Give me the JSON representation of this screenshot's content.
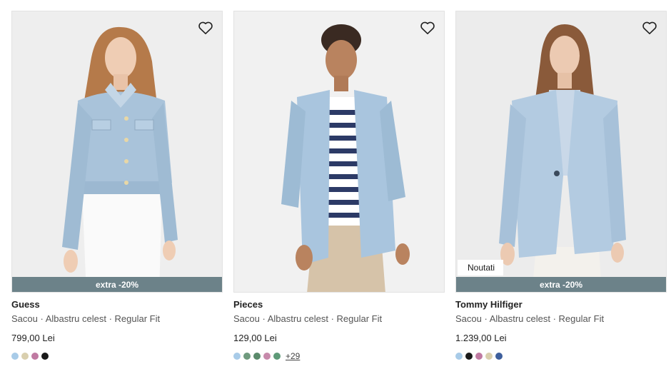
{
  "products": [
    {
      "brand": "Guess",
      "desc": "Sacou · Albastru celest · Regular Fit",
      "price": "799,00 Lei",
      "promo": "extra -20%",
      "badge": "",
      "image": "model-wearing-light-blue-tweed-jacket",
      "swatches": [
        "#a8cbe8",
        "#d9cfae",
        "#c07aa2",
        "#1a1a1a"
      ],
      "more": ""
    },
    {
      "brand": "Pieces",
      "desc": "Sacou · Albastru celest · Regular Fit",
      "price": "129,00 Lei",
      "promo": "",
      "badge": "",
      "image": "model-wearing-light-blue-blazer-striped-top",
      "swatches": [
        "#a8cbe8",
        "#6f9a7e",
        "#5b8a6b",
        "#c78aab",
        "#5e9a78"
      ],
      "more": "+29"
    },
    {
      "brand": "Tommy Hilfiger",
      "desc": "Sacou · Albastru celest · Regular Fit",
      "price": "1.239,00 Lei",
      "promo": "extra -20%",
      "badge": "Noutati",
      "image": "model-wearing-light-blue-tailored-blazer",
      "swatches": [
        "#a8cbe8",
        "#1a1a1a",
        "#c07aa2",
        "#d9cfae",
        "#3e5f9c"
      ],
      "more": ""
    }
  ],
  "icons": {
    "favorite": "heart-outline-icon"
  },
  "colors": {
    "promo_bg": "#6c8289",
    "photo_bg": "#efefef"
  }
}
